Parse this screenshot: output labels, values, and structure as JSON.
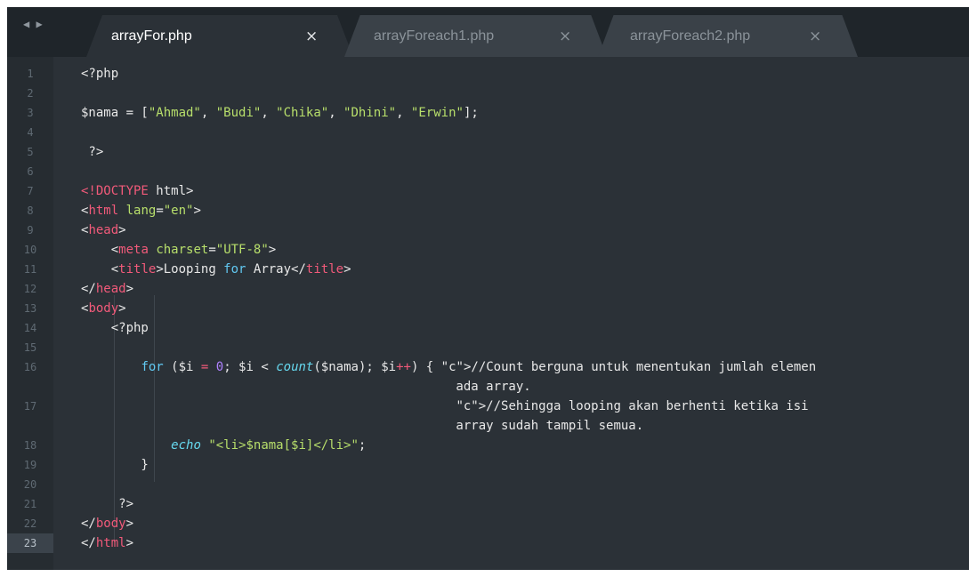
{
  "tabs": [
    {
      "name": "arrayFor.php",
      "active": true
    },
    {
      "name": "arrayForeach1.php",
      "active": false
    },
    {
      "name": "arrayForeach2.php",
      "active": false
    }
  ],
  "nav_arrows": "◀ ▶",
  "close_glyph": "×",
  "lines": [
    {
      "num": "1",
      "text": "<?php"
    },
    {
      "num": "2",
      "text": ""
    },
    {
      "num": "3",
      "text": "$nama = [\"Ahmad\", \"Budi\", \"Chika\", \"Dhini\", \"Erwin\"];"
    },
    {
      "num": "4",
      "text": ""
    },
    {
      "num": "5",
      "text": " ?>"
    },
    {
      "num": "6",
      "text": ""
    },
    {
      "num": "7",
      "text": "<!DOCTYPE html>"
    },
    {
      "num": "8",
      "text": "<html lang=\"en\">"
    },
    {
      "num": "9",
      "text": "<head>"
    },
    {
      "num": "10",
      "text": "    <meta charset=\"UTF-8\">"
    },
    {
      "num": "11",
      "text": "    <title>Looping for Array</title>"
    },
    {
      "num": "12",
      "text": "</head>"
    },
    {
      "num": "13",
      "text": "<body>"
    },
    {
      "num": "14",
      "text": "    <?php"
    },
    {
      "num": "15",
      "text": ""
    },
    {
      "num": "16",
      "text": "        for ($i = 0; $i < count($nama); $i++) { //Count berguna untuk menentukan jumlah elemen"
    },
    {
      "num": "",
      "text": "                                                  ada array."
    },
    {
      "num": "17",
      "text": "                                                  //Sehingga looping akan berhenti ketika isi"
    },
    {
      "num": "",
      "text": "                                                  array sudah tampil semua."
    },
    {
      "num": "18",
      "text": "            echo \"<li>$nama[$i]</li>\";"
    },
    {
      "num": "19",
      "text": "        }"
    },
    {
      "num": "20",
      "text": ""
    },
    {
      "num": "21",
      "text": "     ?>"
    },
    {
      "num": "22",
      "text": "</body>"
    },
    {
      "num": "23",
      "text": "</html>"
    }
  ],
  "current_line": "23"
}
